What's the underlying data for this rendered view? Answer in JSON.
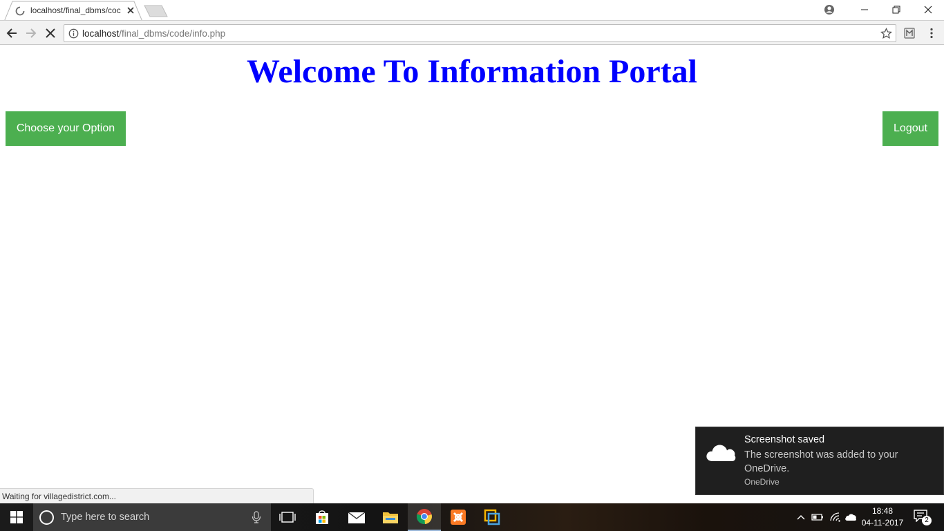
{
  "browser": {
    "tab_title": "localhost/final_dbms/coc",
    "url_host": "localhost",
    "url_path": "/final_dbms/code/info.php",
    "status_text": "Waiting for villagedistrict.com..."
  },
  "page": {
    "title": "Welcome To Information Portal",
    "choose_label": "Choose your Option",
    "logout_label": "Logout",
    "title_color": "#0000ff",
    "button_color": "#4caf50"
  },
  "toast": {
    "title": "Screenshot saved",
    "body": "The screenshot was added to your OneDrive.",
    "source": "OneDrive"
  },
  "taskbar": {
    "search_placeholder": "Type here to search",
    "time": "18:48",
    "date": "04-11-2017",
    "notification_count": "2",
    "pinned_icons": [
      "task-view-icon",
      "store-icon",
      "mail-icon",
      "file-explorer-icon",
      "chrome-icon",
      "xampp-icon",
      "vmware-icon"
    ]
  }
}
